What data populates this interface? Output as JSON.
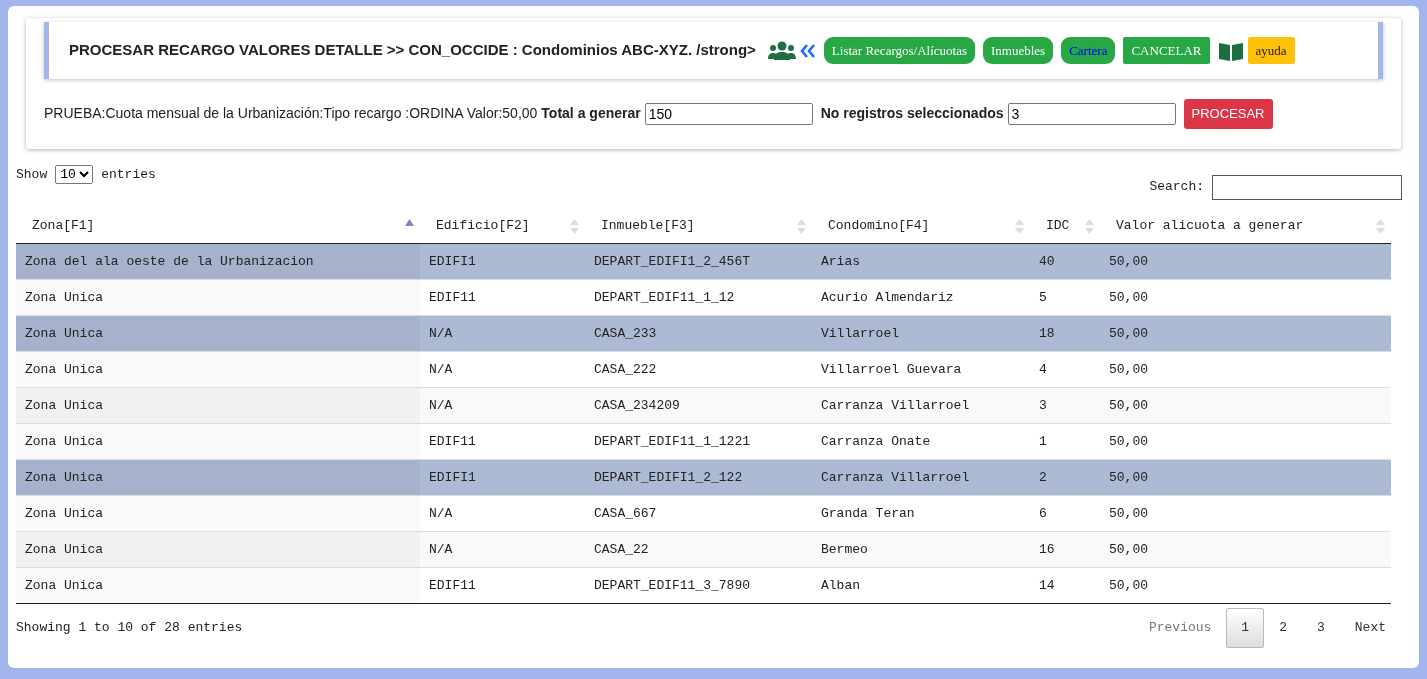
{
  "header": {
    "title": "PROCESAR RECARGO VALORES DETALLE >> CON_OCCIDE : Condominios ABC-XYZ. /strong>",
    "buttons": [
      {
        "label": "Listar Recargos/Alícuotas",
        "kind": "pill"
      },
      {
        "label": "Inmuebles",
        "kind": "pill"
      },
      {
        "label": "Cartera",
        "kind": "link"
      },
      {
        "label": "CANCELAR",
        "kind": "square"
      }
    ],
    "help_button": {
      "label": "ayuda"
    }
  },
  "summary": {
    "description": "PRUEBA:Cuota mensual de la Urbanización:Tipo recargo :ORDINA Valor:50,00",
    "total_label": "Total a generar",
    "total_value": "150",
    "selected_label": "No registros seleccionados",
    "selected_value": "3",
    "process_button": "PROCESAR"
  },
  "table_controls": {
    "show_label": "Show",
    "page_size": "10",
    "entries_label": "entries",
    "search_label": "Search:"
  },
  "table": {
    "columns": [
      {
        "label": "Zona[F1]",
        "sorted": true
      },
      {
        "label": "Edificio[F2]",
        "sorted": false
      },
      {
        "label": "Inmueble[F3]",
        "sorted": false
      },
      {
        "label": "Condomino[F4]",
        "sorted": false
      },
      {
        "label": "IDC",
        "sorted": false
      },
      {
        "label": "Valor alicuota a generar",
        "sorted": false
      }
    ],
    "rows": [
      {
        "selected": true,
        "cells": [
          "Zona del ala oeste de la Urbanizacion",
          "EDIFI1",
          "DEPART_EDIFI1_2_456T",
          "Arias",
          "40",
          "50,00"
        ]
      },
      {
        "selected": false,
        "cells": [
          "Zona Unica",
          "EDIF11",
          "DEPART_EDIF11_1_12",
          "Acurio Almendariz",
          "5",
          "50,00"
        ]
      },
      {
        "selected": true,
        "cells": [
          "Zona Unica",
          "N/A",
          "CASA_233",
          "Villarroel",
          "18",
          "50,00"
        ]
      },
      {
        "selected": false,
        "cells": [
          "Zona Unica",
          "N/A",
          "CASA_222",
          "Villarroel Guevara",
          "4",
          "50,00"
        ]
      },
      {
        "selected": false,
        "cells": [
          "Zona Unica",
          "N/A",
          "CASA_234209",
          "Carranza Villarroel",
          "3",
          "50,00"
        ]
      },
      {
        "selected": false,
        "cells": [
          "Zona Unica",
          "EDIF11",
          "DEPART_EDIF11_1_1221",
          "Carranza Onate",
          "1",
          "50,00"
        ]
      },
      {
        "selected": true,
        "cells": [
          "Zona Unica",
          "EDIFI1",
          "DEPART_EDIFI1_2_122",
          "Carranza Villarroel",
          "2",
          "50,00"
        ]
      },
      {
        "selected": false,
        "cells": [
          "Zona Unica",
          "N/A",
          "CASA_667",
          "Granda Teran",
          "6",
          "50,00"
        ]
      },
      {
        "selected": false,
        "cells": [
          "Zona Unica",
          "N/A",
          "CASA_22",
          "Bermeo",
          "16",
          "50,00"
        ]
      },
      {
        "selected": false,
        "cells": [
          "Zona Unica",
          "EDIF11",
          "DEPART_EDIF11_3_7890",
          "Alban",
          "14",
          "50,00"
        ]
      }
    ]
  },
  "footer": {
    "info": "Showing 1 to 10 of 28 entries",
    "previous": {
      "label": "Previous",
      "disabled": true
    },
    "pages": [
      {
        "label": "1",
        "selected": true
      },
      {
        "label": "2",
        "selected": false
      },
      {
        "label": "3",
        "selected": false
      }
    ],
    "next": {
      "label": "Next",
      "disabled": false
    }
  }
}
